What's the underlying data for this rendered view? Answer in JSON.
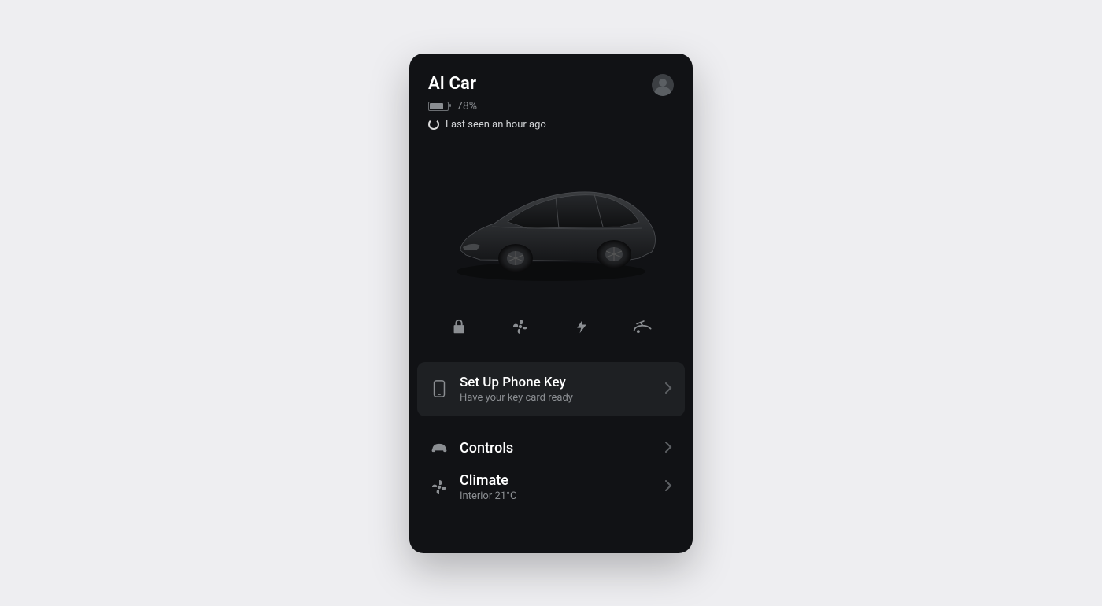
{
  "car": {
    "name": "Al Car",
    "battery_pct_label": "78%",
    "battery_pct": 78,
    "status": "Last seen an hour ago"
  },
  "quick_actions": {
    "lock": "lock",
    "fan": "fan",
    "charge": "charge",
    "frunk": "frunk"
  },
  "phone_key_card": {
    "title": "Set Up Phone Key",
    "subtitle": "Have your key card ready"
  },
  "menu": {
    "controls": {
      "title": "Controls"
    },
    "climate": {
      "title": "Climate",
      "subtitle": "Interior 21°C"
    }
  }
}
